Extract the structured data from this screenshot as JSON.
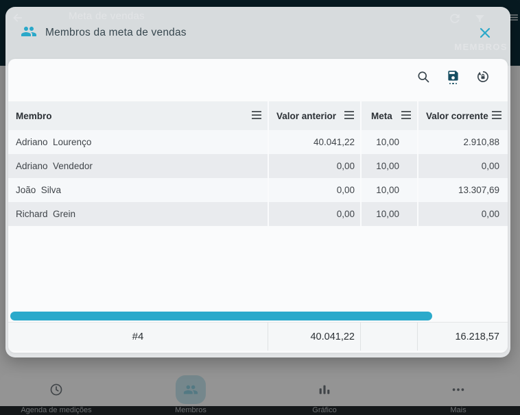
{
  "colors": {
    "accent": "#2BA8C9",
    "app_bar_bg": "#0D2E39",
    "save_icon": "#174E61",
    "scrollbar": "#2BAACB",
    "row_light": "#F6F8FA",
    "row_dark": "#E9EBEE"
  },
  "background": {
    "app_bar": {
      "title": "Meta de vendas"
    },
    "tabs": {
      "active": "MEMBROS"
    },
    "bottom_nav": {
      "items": [
        {
          "label": "Agenda de medições"
        },
        {
          "label": "Membros"
        },
        {
          "label": "Gráfico"
        },
        {
          "label": "Mais"
        }
      ]
    }
  },
  "modal": {
    "title": "Membros da meta de vendas",
    "toolbar": {
      "icons": [
        "search-icon",
        "save-icon",
        "lock-reset-icon"
      ]
    },
    "table": {
      "columns": [
        "Membro",
        "Valor anterior",
        "Meta",
        "Valor corrente"
      ],
      "rows": [
        {
          "member": "Adriano  Lourenço",
          "previous": "40.041,22",
          "goal": "10,00",
          "current": "2.910,88"
        },
        {
          "member": "Adriano  Vendedor",
          "previous": "0,00",
          "goal": "10,00",
          "current": "0,00"
        },
        {
          "member": "João  Silva",
          "previous": "0,00",
          "goal": "10,00",
          "current": "13.307,69"
        },
        {
          "member": "Richard  Grein",
          "previous": "0,00",
          "goal": "10,00",
          "current": "0,00"
        }
      ],
      "footer": {
        "count": "#4",
        "previous": "40.041,22",
        "goal": "",
        "current": "16.218,57"
      }
    }
  }
}
